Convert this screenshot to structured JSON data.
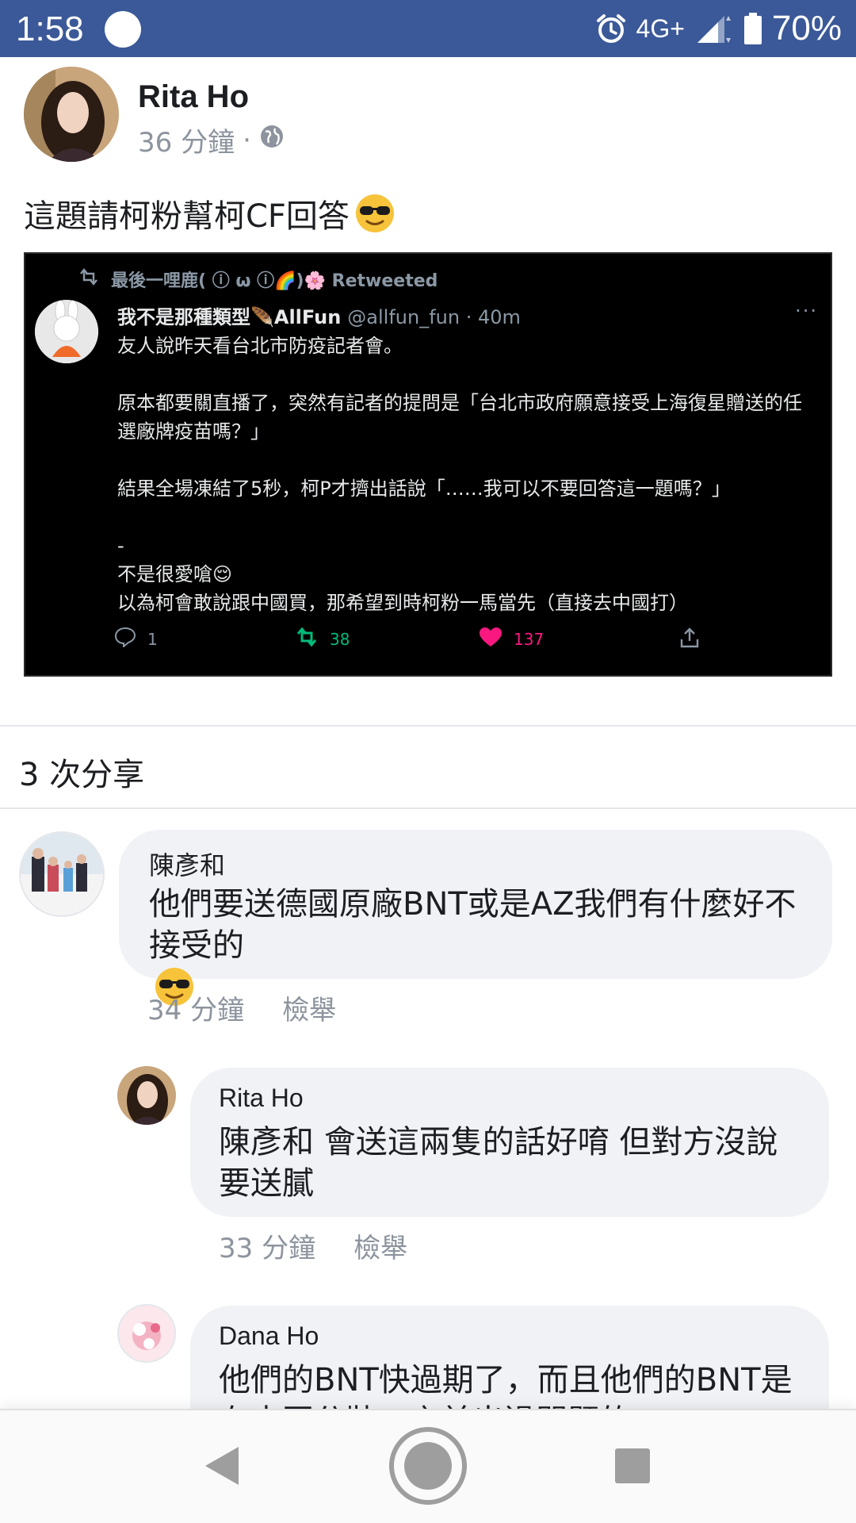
{
  "status_bar": {
    "time": "1:58",
    "network": "4G+",
    "battery": "70%",
    "background_color": "#3b5998"
  },
  "post": {
    "author": "Rita Ho",
    "time": "36 分鐘",
    "separator": "·",
    "privacy_icon": "globe-icon",
    "text": "這題請柯粉幫柯CF回答",
    "emoji": "smiling-face-with-sunglasses"
  },
  "tweet": {
    "retweeted_by": "最後一哩鹿( ⓘ ω ⓘ🌈)🌸 Retweeted",
    "name": "我不是那種類型🪶AllFun",
    "handle": "@allfun_fun · 40m",
    "more": "···",
    "body": "友人說昨天看台北市防疫記者會。\n\n原本都要關直播了，突然有記者的提問是「台北市政府願意接受上海復星贈送的任選廠牌疫苗嗎？」\n\n結果全場凍結了5秒，柯P才擠出話說「……我可以不要回答這一題嗎？」\n\n-\n不是很愛嗆😌\n以為柯會敢說跟中國買，那希望到時柯粉一馬當先（直接去中國打）",
    "replies": "1",
    "retweets": "38",
    "likes": "137"
  },
  "shares": {
    "label": "3 次分享"
  },
  "comments": [
    {
      "author": "陳彥和",
      "text": "他們要送德國原廠BNT或是AZ我們有什麼好不接受的",
      "time": "34 分鐘",
      "report": "檢舉"
    },
    {
      "author": "Rita Ho",
      "text": "陳彥和 會送這兩隻的話好唷 但對方沒說要送膩",
      "time": "33 分鐘",
      "report": "檢舉"
    },
    {
      "author": "Dana Ho",
      "text": "他們的BNT快過期了，而且他們的BNT是在中國分裝，之前出過問題的"
    }
  ],
  "nav": {
    "back_icon": "back-triangle-icon",
    "home_icon": "home-circle-icon",
    "recents_icon": "recents-square-icon"
  }
}
